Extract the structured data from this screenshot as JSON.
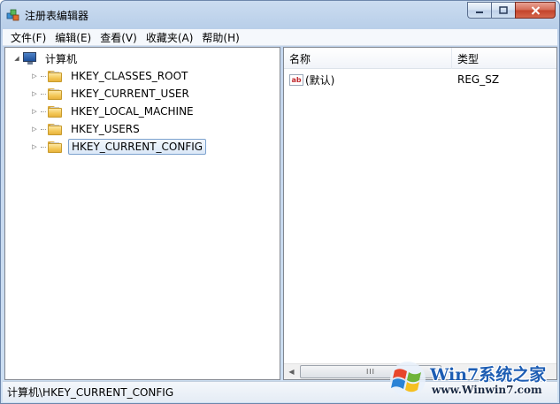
{
  "window": {
    "title": "注册表编辑器"
  },
  "menu": [
    "文件(F)",
    "编辑(E)",
    "查看(V)",
    "收藏夹(A)",
    "帮助(H)"
  ],
  "tree": {
    "root": "计算机",
    "children": [
      "HKEY_CLASSES_ROOT",
      "HKEY_CURRENT_USER",
      "HKEY_LOCAL_MACHINE",
      "HKEY_USERS",
      "HKEY_CURRENT_CONFIG"
    ],
    "selected": "HKEY_CURRENT_CONFIG"
  },
  "list": {
    "columns": {
      "name": "名称",
      "type": "类型"
    },
    "rows": [
      {
        "name": "(默认)",
        "type": "REG_SZ",
        "icon": "string-value-icon"
      }
    ],
    "icon_text": "ab"
  },
  "scrollbar": {
    "thumb_grip": "III"
  },
  "status": "计算机\\HKEY_CURRENT_CONFIG",
  "watermark": {
    "brand": "Win7系统之家",
    "url": "www.Winwin7.com"
  },
  "colors": {
    "accent": "#1d5db3",
    "selection": "#dbe8f7",
    "folder": "#f3c755"
  }
}
